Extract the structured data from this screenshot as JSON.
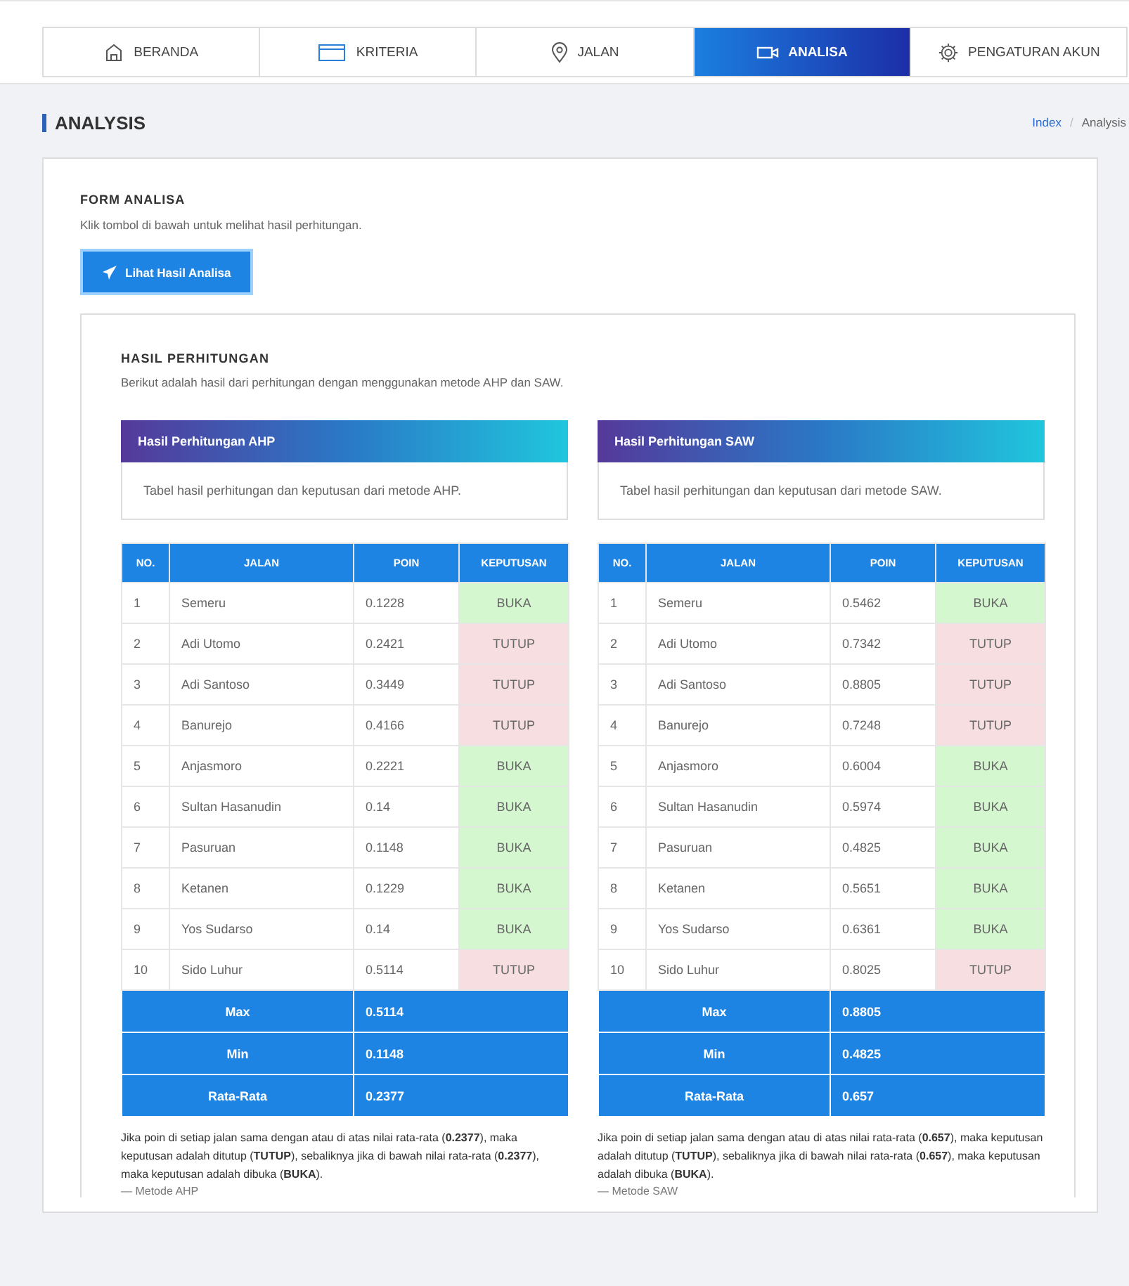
{
  "nav": [
    {
      "label": "BERANDA",
      "selected": false
    },
    {
      "label": "KRITERIA",
      "selected": false
    },
    {
      "label": "JALAN",
      "selected": false
    },
    {
      "label": "ANALISA",
      "selected": true
    },
    {
      "label": "PENGATURAN AKUN",
      "selected": false
    }
  ],
  "page_title": "ANALYSIS",
  "breadcrumb": [
    {
      "label": "Index",
      "link": true
    },
    {
      "label": "/",
      "link": false
    },
    {
      "label": "Analysis",
      "link": false
    }
  ],
  "form": {
    "title": "FORM ANALISA",
    "description": "Klik tombol di bawah untuk melihat hasil perhitungan.",
    "button": "Lihat Hasil Analisa"
  },
  "results": {
    "title": "HASIL PERHITUNGAN",
    "description": "Berikut adalah hasil dari perhitungan dengan menggunakan metode AHP dan SAW.",
    "panels": [
      {
        "heading": "Hasil Perhitungan AHP",
        "caption": "Tabel hasil perhitungan dan keputusan dari metode AHP.",
        "columns": [
          "NO.",
          "JALAN",
          "POIN",
          "KEPUTUSAN"
        ],
        "rows": [
          {
            "no": "1",
            "jalan": "Semeru",
            "poin": "0.1228",
            "keputusan": "BUKA",
            "color": "#d5f7d0"
          },
          {
            "no": "2",
            "jalan": "Adi Utomo",
            "poin": "0.2421",
            "keputusan": "TUTUP",
            "color": "#f7dfe1"
          },
          {
            "no": "3",
            "jalan": "Adi Santoso",
            "poin": "0.3449",
            "keputusan": "TUTUP",
            "color": "#f7dfe1"
          },
          {
            "no": "4",
            "jalan": "Banurejo",
            "poin": "0.4166",
            "keputusan": "TUTUP",
            "color": "#f7dfe1"
          },
          {
            "no": "5",
            "jalan": "Anjasmoro",
            "poin": "0.2221",
            "keputusan": "BUKA",
            "color": "#d5f7d0"
          },
          {
            "no": "6",
            "jalan": "Sultan Hasanudin",
            "poin": "0.14",
            "keputusan": "BUKA",
            "color": "#d5f7d0"
          },
          {
            "no": "7",
            "jalan": "Pasuruan",
            "poin": "0.1148",
            "keputusan": "BUKA",
            "color": "#d5f7d0"
          },
          {
            "no": "8",
            "jalan": "Ketanen",
            "poin": "0.1229",
            "keputusan": "BUKA",
            "color": "#d5f7d0"
          },
          {
            "no": "9",
            "jalan": "Yos Sudarso",
            "poin": "0.14",
            "keputusan": "BUKA",
            "color": "#d5f7d0"
          },
          {
            "no": "10",
            "jalan": "Sido Luhur",
            "poin": "0.5114",
            "keputusan": "TUTUP",
            "color": "#f7dfe1"
          }
        ],
        "summary": [
          {
            "label": "Max",
            "value": "0.5114"
          },
          {
            "label": "Min",
            "value": "0.1148"
          },
          {
            "label": "Rata-Rata",
            "value": "0.2377"
          }
        ],
        "note": "Jika poin di setiap jalan sama dengan atau di atas nilai rata-rata (**0.2377**), maka keputusan adalah ditutup (**TUTUP**), sebaliknya jika di bawah nilai rata-rata (**0.2377**), maka keputusan adalah dibuka (**BUKA**).",
        "source": "— Metode AHP"
      },
      {
        "heading": "Hasil Perhitungan SAW",
        "caption": "Tabel hasil perhitungan dan keputusan dari metode SAW.",
        "columns": [
          "NO.",
          "JALAN",
          "POIN",
          "KEPUTUSAN"
        ],
        "rows": [
          {
            "no": "1",
            "jalan": "Semeru",
            "poin": "0.5462",
            "keputusan": "BUKA",
            "color": "#d5f7d0"
          },
          {
            "no": "2",
            "jalan": "Adi Utomo",
            "poin": "0.7342",
            "keputusan": "TUTUP",
            "color": "#f7dfe1"
          },
          {
            "no": "3",
            "jalan": "Adi Santoso",
            "poin": "0.8805",
            "keputusan": "TUTUP",
            "color": "#f7dfe1"
          },
          {
            "no": "4",
            "jalan": "Banurejo",
            "poin": "0.7248",
            "keputusan": "TUTUP",
            "color": "#f7dfe1"
          },
          {
            "no": "5",
            "jalan": "Anjasmoro",
            "poin": "0.6004",
            "keputusan": "BUKA",
            "color": "#d5f7d0"
          },
          {
            "no": "6",
            "jalan": "Sultan Hasanudin",
            "poin": "0.5974",
            "keputusan": "BUKA",
            "color": "#d5f7d0"
          },
          {
            "no": "7",
            "jalan": "Pasuruan",
            "poin": "0.4825",
            "keputusan": "BUKA",
            "color": "#d5f7d0"
          },
          {
            "no": "8",
            "jalan": "Ketanen",
            "poin": "0.5651",
            "keputusan": "BUKA",
            "color": "#d5f7d0"
          },
          {
            "no": "9",
            "jalan": "Yos Sudarso",
            "poin": "0.6361",
            "keputusan": "BUKA",
            "color": "#d5f7d0"
          },
          {
            "no": "10",
            "jalan": "Sido Luhur",
            "poin": "0.8025",
            "keputusan": "TUTUP",
            "color": "#f7dfe1"
          }
        ],
        "summary": [
          {
            "label": "Max",
            "value": "0.8805"
          },
          {
            "label": "Min",
            "value": "0.4825"
          },
          {
            "label": "Rata-Rata",
            "value": "0.657"
          }
        ],
        "note": "Jika poin di setiap jalan sama dengan atau di atas nilai rata-rata (**0.657**), maka keputusan adalah ditutup (**TUTUP**), sebaliknya jika di bawah nilai rata-rata (**0.657**), maka keputusan adalah dibuka (**BUKA**).",
        "source": "— Metode SAW"
      }
    ]
  }
}
